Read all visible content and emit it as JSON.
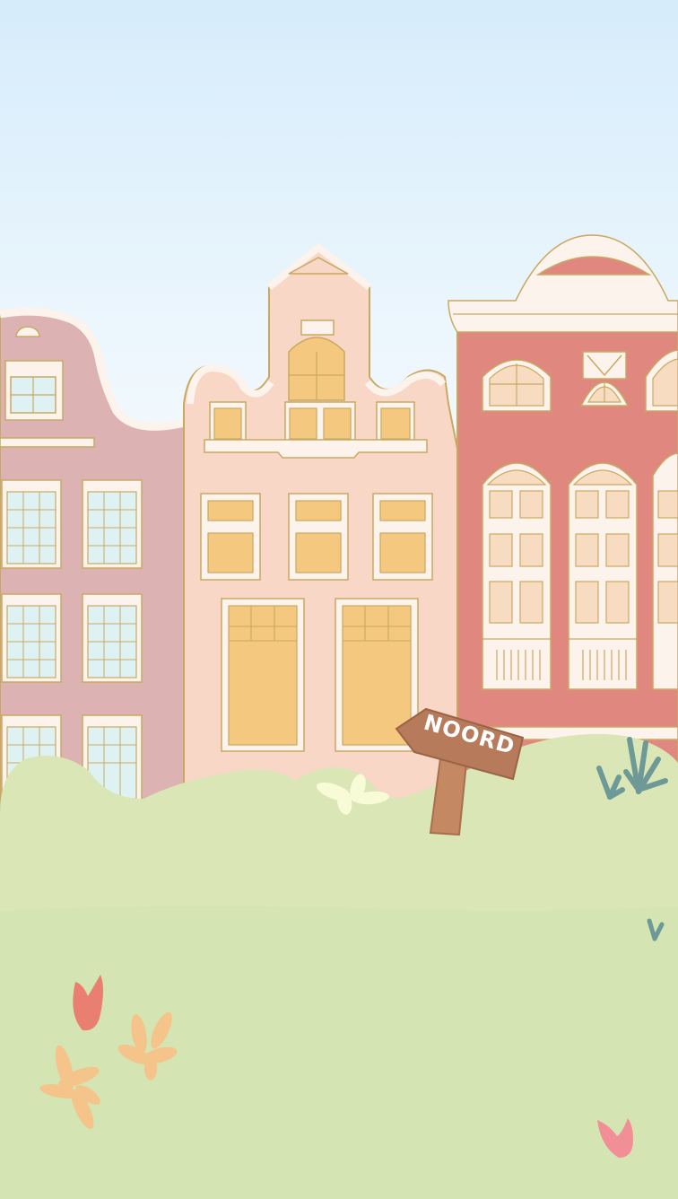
{
  "scene": {
    "sign_text": "NOORD"
  },
  "palette": {
    "sky_top": "#d6ecfb",
    "sky_bottom": "#ffffff",
    "outline": "#c9a961",
    "trim": "#fbf3ec",
    "window_glass": "#dff2f3",
    "window_warm": "#f4c87f",
    "house_left": "#dcb3b2",
    "house_middle": "#f8d7c7",
    "house_right": "#e0877f",
    "grass_light": "#dae6b6",
    "grass": "#d4e4b2",
    "sign_wood": "#b77b5b",
    "sign_post": "#c48962",
    "sign_text": "#ffffff",
    "plant_teal": "#6d9996",
    "flower_red": "#e87f71",
    "flower_orange": "#f4c48a",
    "flower_pink": "#f28e96",
    "flower_yellow": "#f7fbd6"
  }
}
